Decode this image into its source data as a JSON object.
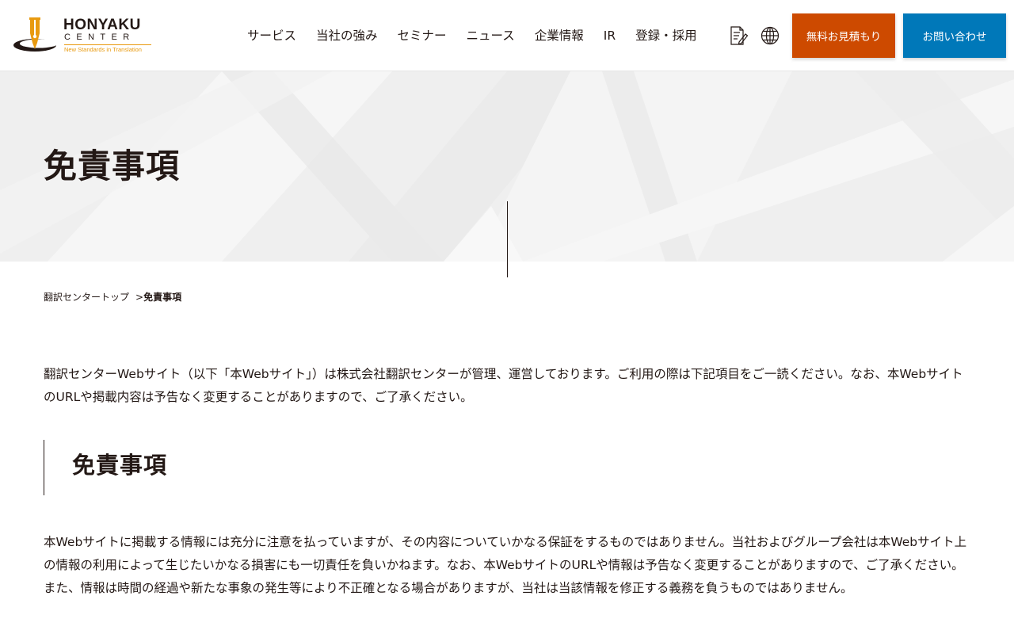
{
  "header": {
    "logo": {
      "name": "HONYAKU",
      "sub": "CENTER",
      "tagline": "New Standards in Translation"
    },
    "nav": [
      {
        "label": "サービス"
      },
      {
        "label": "当社の強み"
      },
      {
        "label": "セミナー"
      },
      {
        "label": "ニュース"
      },
      {
        "label": "企業情報"
      },
      {
        "label": "IR"
      },
      {
        "label": "登録・採用"
      }
    ],
    "icons": [
      "document-edit-icon",
      "globe-icon"
    ],
    "quote_button": "無料お見積もり",
    "contact_button": "お問い合わせ",
    "colors": {
      "quote": "#cd4a00",
      "contact": "#0078b9",
      "logo_accent": "#e89a10"
    }
  },
  "hero": {
    "title": "免責事項"
  },
  "breadcrumb": {
    "home": "翻訳センタートップ",
    "separator": ">",
    "current": "免責事項"
  },
  "main": {
    "intro": "翻訳センターWebサイト（以下「本Webサイト」）は株式会社翻訳センターが管理、運営しております。ご利用の際は下記項目をご一読ください。なお、本WebサイトのURLや掲載内容は予告なく変更することがありますので、ご了承ください。",
    "section_title": "免責事項",
    "section_text": "本Webサイトに掲載する情報には充分に注意を払っていますが、その内容についていかなる保証をするものではありません。当社およびグループ会社は本Webサイト上の情報の利用によって生じたいかなる損害にも一切責任を負いかねます。なお、本WebサイトのURLや情報は予告なく変更することがありますので、ご了承ください。また、情報は時間の経過や新たな事象の発生等により不正確となる場合がありますが、当社は当該情報を修正する義務を負うものではありません。"
  }
}
